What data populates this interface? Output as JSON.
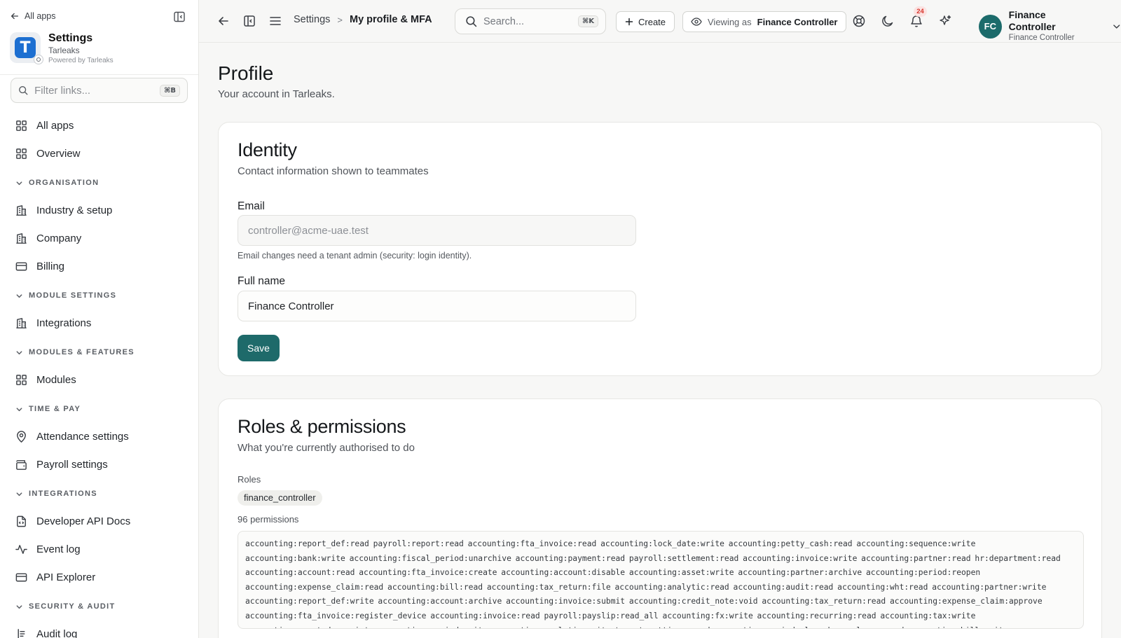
{
  "sidebar": {
    "back_label": "All apps",
    "brand": {
      "title": "Settings",
      "subtitle": "Tarleaks",
      "powered": "Powered by Tarleaks",
      "logo_letter": "T",
      "logo_color": "#1d6fd1"
    },
    "filter": {
      "placeholder": "Filter links...",
      "shortcut": "⌘B"
    },
    "top_items": [
      {
        "label": "All apps",
        "icon": "grid-icon"
      },
      {
        "label": "Overview",
        "icon": "grid-icon"
      }
    ],
    "sections": [
      {
        "title": "ORGANISATION",
        "items": [
          {
            "label": "Industry & setup",
            "icon": "building-icon"
          },
          {
            "label": "Company",
            "icon": "building-icon"
          },
          {
            "label": "Billing",
            "icon": "credit-card-icon"
          }
        ]
      },
      {
        "title": "MODULE SETTINGS",
        "items": [
          {
            "label": "Integrations",
            "icon": "building-icon"
          }
        ]
      },
      {
        "title": "MODULES & FEATURES",
        "items": [
          {
            "label": "Modules",
            "icon": "grid-icon"
          }
        ]
      },
      {
        "title": "TIME & PAY",
        "items": [
          {
            "label": "Attendance settings",
            "icon": "map-pin-icon"
          },
          {
            "label": "Payroll settings",
            "icon": "wallet-icon"
          }
        ]
      },
      {
        "title": "INTEGRATIONS",
        "items": [
          {
            "label": "Developer API Docs",
            "icon": "file-code-icon"
          },
          {
            "label": "Event log",
            "icon": "activity-icon"
          },
          {
            "label": "API Explorer",
            "icon": "credit-card-icon"
          }
        ]
      },
      {
        "title": "SECURITY & AUDIT",
        "items": [
          {
            "label": "Audit log",
            "icon": "list-icon"
          }
        ]
      }
    ]
  },
  "topbar": {
    "breadcrumb": {
      "parent": "Settings",
      "separator": ">",
      "current": "My profile & MFA"
    },
    "search": {
      "placeholder": "Search...",
      "shortcut": "⌘K"
    },
    "create_label": "Create",
    "viewing": {
      "label": "Viewing as",
      "value": "Finance Controller"
    },
    "notifications_count": "24",
    "user": {
      "initials": "FC",
      "name": "Finance Controller",
      "role": "Finance Controller",
      "avatar_color": "#1c6b6b"
    }
  },
  "page": {
    "title": "Profile",
    "subtitle": "Your account in Tarleaks."
  },
  "identity": {
    "title": "Identity",
    "subtitle": "Contact information shown to teammates",
    "email_label": "Email",
    "email_value": "controller@acme-uae.test",
    "email_help": "Email changes need a tenant admin (security: login identity).",
    "name_label": "Full name",
    "name_value": "Finance Controller",
    "save_label": "Save",
    "accent_color": "#1e6a6a"
  },
  "roles": {
    "title": "Roles & permissions",
    "subtitle": "What you're currently authorised to do",
    "roles_label": "Roles",
    "role_chip": "finance_controller",
    "permissions_count": "96 permissions",
    "permissions_text": "accounting:report_def:read payroll:report:read accounting:fta_invoice:read accounting:lock_date:write accounting:petty_cash:read accounting:sequence:write accounting:bank:write accounting:fiscal_period:unarchive accounting:payment:read payroll:settlement:read accounting:invoice:write accounting:partner:read hr:department:read accounting:account:read accounting:fta_invoice:create accounting:account:disable accounting:asset:write accounting:partner:archive accounting:period:reopen accounting:expense_claim:read accounting:bill:read accounting:tax_return:file accounting:analytic:read accounting:audit:read accounting:wht:read accounting:partner:write accounting:report_def:write accounting:account:archive accounting:invoice:submit accounting:credit_note:void accounting:tax_return:read accounting:expense_claim:approve accounting:fta_invoice:register_device accounting:invoice:read payroll:payslip:read_all accounting:fx:write accounting:recurring:read accounting:tax:write accounting:asset:depreciate accounting:period:write accounting:analytic:write tenant:settings:read accounting:period:close hr:employee:read accounting:bill:write accounting:expense_claim:post accounting:pdc:read"
  }
}
